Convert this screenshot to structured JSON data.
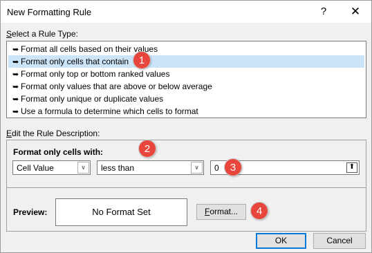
{
  "window": {
    "title": "New Formatting Rule",
    "help_label": "?",
    "close_label": "✕"
  },
  "rule_type": {
    "label_prefix": "S",
    "label_rest": "elect a Rule Type:",
    "selected_index": 1,
    "items": [
      "Format all cells based on their values",
      "Format only cells that contain",
      "Format only top or bottom ranked values",
      "Format only values that are above or below average",
      "Format only unique or duplicate values",
      "Use a formula to determine which cells to format"
    ]
  },
  "description": {
    "label_prefix": "E",
    "label_rest": "dit the Rule Description:",
    "format_only_prefix": "Format only cells with:",
    "condition_type": "Cell Value",
    "operator": "less than",
    "value": "0",
    "preview_label": "Preview:",
    "preview_text": "No Format Set",
    "format_button_prefix": "F",
    "format_button_rest": "ormat..."
  },
  "footer": {
    "ok_label": "OK",
    "cancel_label": "Cancel"
  },
  "badges": [
    "1",
    "2",
    "3",
    "4"
  ],
  "colors": {
    "badge": "#e8453c",
    "selection": "#cce4f7",
    "default_button_border": "#0078d7"
  }
}
